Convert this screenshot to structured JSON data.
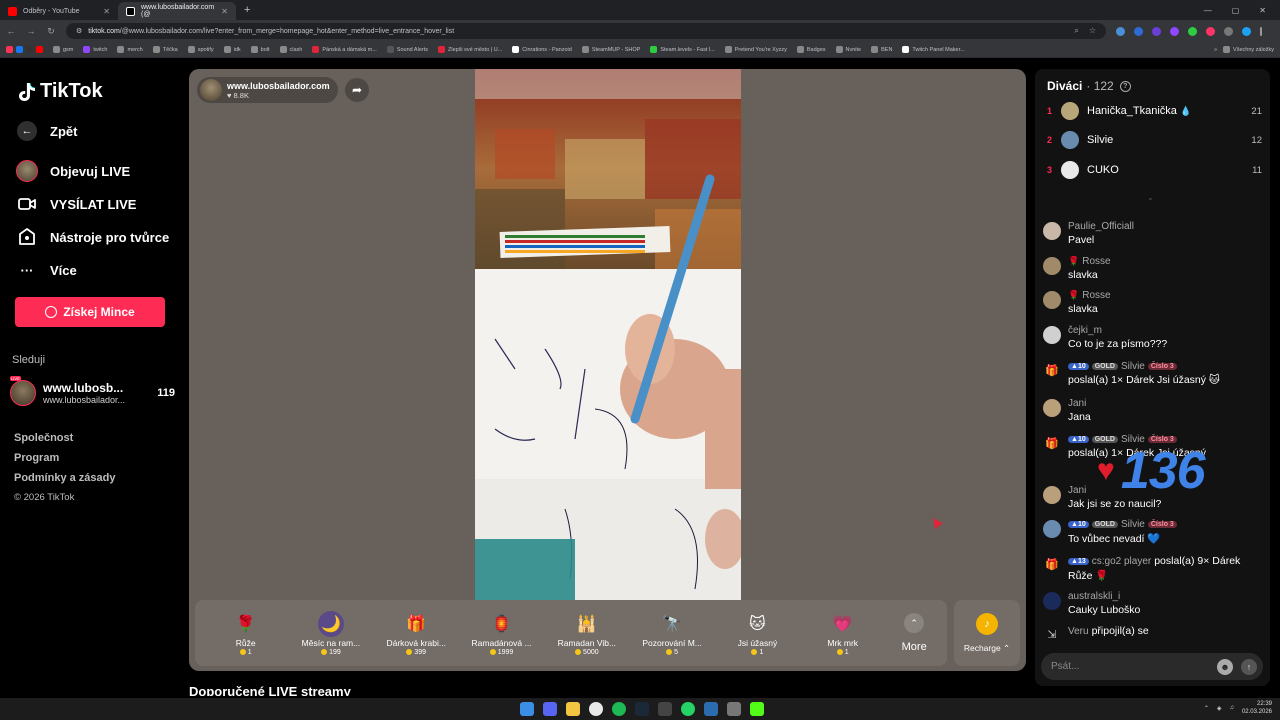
{
  "browser": {
    "tabs": [
      {
        "title": "Odběry - YouTube",
        "color": "#ff0000"
      },
      {
        "title": "www.lubosbailador.com (@",
        "color": "#ffffff"
      }
    ],
    "url_prefix": "tiktok.com",
    "url_rest": "/@www.lubosbailador.com/live?enter_from_merge=homepage_hot&enter_method=live_entrance_hover_list",
    "bookmarks": [
      "gsm",
      "twitch",
      "merch",
      "Těčka",
      "spotify",
      "idk",
      "bolt",
      "clash",
      "Pánská a dámská m...",
      "Sound Alerts",
      "Zlepši své město | U...",
      "Cinrations - Panzoid",
      "SteamMUP - SHOP",
      "Steam.levels - Fast l...",
      "Pretend You're Xyzzy",
      "Badges",
      "Nvnite",
      "BEN",
      "Twitch Panel Maker..."
    ],
    "all_bookmarks": "Všechny záložky"
  },
  "sidebar": {
    "logo": "TikTok",
    "back": "Zpět",
    "nav": [
      "Objevuj LIVE",
      "VYSÍLAT LIVE",
      "Nástroje pro tvůrce",
      "Více"
    ],
    "coin_button": "Získej Mince",
    "following_label": "Sleduji",
    "following": {
      "name": "www.lubosb...",
      "handle": "www.lubosbailador...",
      "count": "119",
      "badge": "LIVE"
    },
    "footer": [
      "Společnost",
      "Program",
      "Podmínky a zásady"
    ],
    "copyright": "© 2026 TikTok"
  },
  "stream": {
    "channel": "www.lubosbailador.com",
    "likes": "8.8K",
    "gifts": [
      {
        "name": "Růže",
        "price": "1",
        "icon": "🌹",
        "bg": "#00000000"
      },
      {
        "name": "Měsíc na ram...",
        "price": "199",
        "icon": "🌙",
        "bg": "#5a4a8a"
      },
      {
        "name": "Dárková krabi...",
        "price": "399",
        "icon": "🎁",
        "bg": "#00000000"
      },
      {
        "name": "Ramadánová ...",
        "price": "1999",
        "icon": "🏮",
        "bg": "#00000000"
      },
      {
        "name": "Ramadan Vib...",
        "price": "5000",
        "icon": "🕌",
        "bg": "#00000000"
      },
      {
        "name": "Pozorování M...",
        "price": "5",
        "icon": "🔭",
        "bg": "#00000000"
      },
      {
        "name": "Jsi úžasný",
        "price": "1",
        "icon": "🐱",
        "bg": "#00000000"
      },
      {
        "name": "Mrk mrk",
        "price": "1",
        "icon": "💗",
        "bg": "#00000000"
      }
    ],
    "more": "More",
    "recharge": "Recharge"
  },
  "recommended": "Doporučené LIVE streamy",
  "chat": {
    "viewers_label": "Diváci",
    "viewers_count": "· 122",
    "top": [
      {
        "rank": "1",
        "name": "Hanička_Tkanička",
        "score": "21",
        "color": "#b9a57a"
      },
      {
        "rank": "2",
        "name": "Silvie",
        "score": "12",
        "color": "#6a8bb0"
      },
      {
        "rank": "3",
        "name": "CUKO",
        "score": "11",
        "color": "#e8e8e8"
      }
    ],
    "messages": [
      {
        "name": "Paulie_Officiall",
        "text": "Pavel"
      },
      {
        "name": "Rosse",
        "text": "slavka"
      },
      {
        "name": "Rosse",
        "text": "slavka"
      },
      {
        "name": "čejki_m",
        "text": "Co to je za písmo???"
      },
      {
        "lvl": "10",
        "gold": "GOLD",
        "name": "Silvie",
        "num": "Číslo 3",
        "text": "poslal(a) 1× Dárek Jsi úžasný 🐱"
      },
      {
        "name": "Jani",
        "text": "Jana"
      },
      {
        "lvl": "10",
        "gold": "GOLD",
        "name": "Silvie",
        "num": "Číslo 3",
        "text": "poslal(a) 1× Dárek Jsi úžasný"
      },
      {
        "name": "Jani",
        "text": "Jak jsi se zo naucil?"
      },
      {
        "lvl": "10",
        "gold": "GOLD",
        "name": "Silvie",
        "num": "Číslo 3",
        "text": "To vůbec nevadí 💙"
      },
      {
        "lvl": "13",
        "name": "cs:go2 player",
        "inline": "poslal(a) 9× Dárek",
        "text": "Růže 🌹"
      },
      {
        "name": "australskli_i",
        "text": "Cauky Luboško"
      },
      {
        "name": "Veru",
        "inline": "připojil(a) se"
      }
    ],
    "combo_count": "136",
    "input_placeholder": "Psát..."
  },
  "taskbar": {
    "time": "22:39",
    "date": "02.03.2026"
  }
}
